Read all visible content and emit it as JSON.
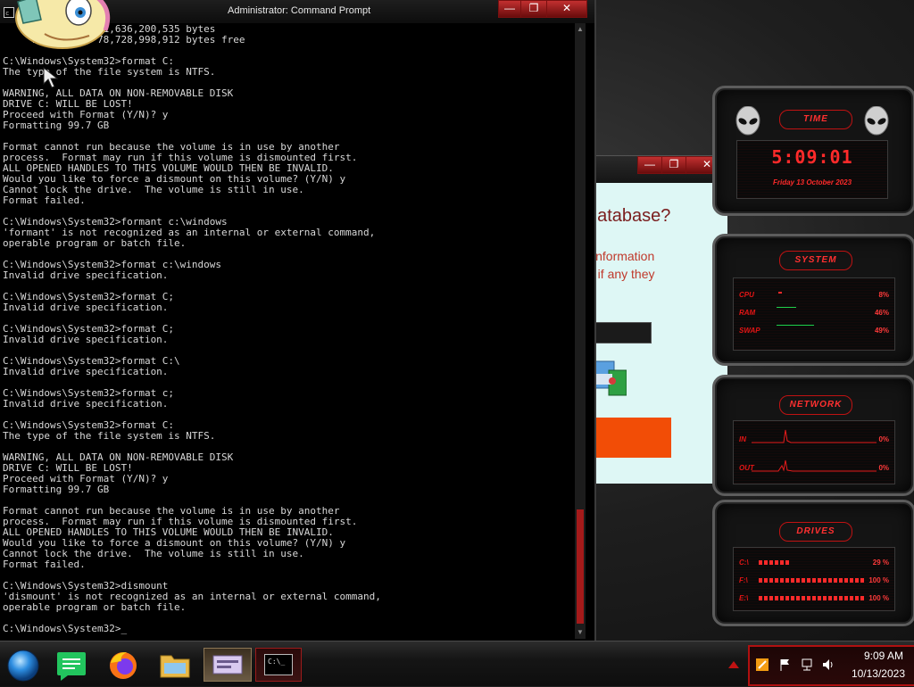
{
  "cmd": {
    "title": "Administrator: Command Prompt",
    "controls": {
      "minimize": "—",
      "maximize": "❐",
      "close": "✕"
    },
    "output": "      5 File(s)  1,636,200,535 bytes\n     21 Dir(s)  78,728,998,912 bytes free\n\nC:\\Windows\\System32>format C:\nThe type of the file system is NTFS.\n\nWARNING, ALL DATA ON NON-REMOVABLE DISK\nDRIVE C: WILL BE LOST!\nProceed with Format (Y/N)? y\nFormatting 99.7 GB\n\nFormat cannot run because the volume is in use by another\nprocess.  Format may run if this volume is dismounted first.\nALL OPENED HANDLES TO THIS VOLUME WOULD THEN BE INVALID.\nWould you like to force a dismount on this volume? (Y/N) y\nCannot lock the drive.  The volume is still in use.\nFormat failed.\n\nC:\\Windows\\System32>formant c:\\windows\n'formant' is not recognized as an internal or external command,\noperable program or batch file.\n\nC:\\Windows\\System32>format c:\\windows\nInvalid drive specification.\n\nC:\\Windows\\System32>format C;\nInvalid drive specification.\n\nC:\\Windows\\System32>format C;\nInvalid drive specification.\n\nC:\\Windows\\System32>format C:\\\nInvalid drive specification.\n\nC:\\Windows\\System32>format c;\nInvalid drive specification.\n\nC:\\Windows\\System32>format C:\nThe type of the file system is NTFS.\n\nWARNING, ALL DATA ON NON-REMOVABLE DISK\nDRIVE C: WILL BE LOST!\nProceed with Format (Y/N)? y\nFormatting 99.7 GB\n\nFormat cannot run because the volume is in use by another\nprocess.  Format may run if this volume is dismounted first.\nALL OPENED HANDLES TO THIS VOLUME WOULD THEN BE INVALID.\nWould you like to force a dismount on this volume? (Y/N) y\nCannot lock the drive.  The volume is still in use.\nFormat failed.\n\nC:\\Windows\\System32>dismount\n'dismount' is not recognized as an internal or external command,\noperable program or batch file.\n\nC:\\Windows\\System32>_"
  },
  "dialog": {
    "question": "database?",
    "info_line1": "information",
    "info_line2": "e if any they",
    "controls": {
      "minimize": "—",
      "maximize": "❐",
      "close": "✕"
    }
  },
  "gadgets": {
    "time": {
      "header": "TIME",
      "clock": "5:09:01",
      "date": "Friday 13 October 2023"
    },
    "system": {
      "header": "SYSTEM",
      "rows": [
        {
          "label": "CPU",
          "value": "8%"
        },
        {
          "label": "RAM",
          "value": "46%"
        },
        {
          "label": "SWAP",
          "value": "49%"
        }
      ]
    },
    "network": {
      "header": "NETWORK",
      "rows": [
        {
          "label": "IN",
          "value": "0%"
        },
        {
          "label": "OUT",
          "value": "0%"
        }
      ]
    },
    "drives": {
      "header": "DRIVES",
      "rows": [
        {
          "label": "C:\\",
          "value": "29 %",
          "fill": 0.29
        },
        {
          "label": "F:\\",
          "value": "100 %",
          "fill": 1.0
        },
        {
          "label": "E:\\",
          "value": "100 %",
          "fill": 1.0
        }
      ]
    }
  },
  "taskbar": {
    "clock_time": "9:09 AM",
    "clock_date": "10/13/2023",
    "apps": [
      "start-orb",
      "messages",
      "firefox",
      "file-explorer",
      "control-panel",
      "command-prompt"
    ],
    "cmd_icon_text": "C:\\_"
  },
  "colors": {
    "accent_red": "#c01212",
    "cmd_bg": "#000000",
    "dialog_bg": "#def7f5",
    "orange_button": "#f24d06"
  }
}
